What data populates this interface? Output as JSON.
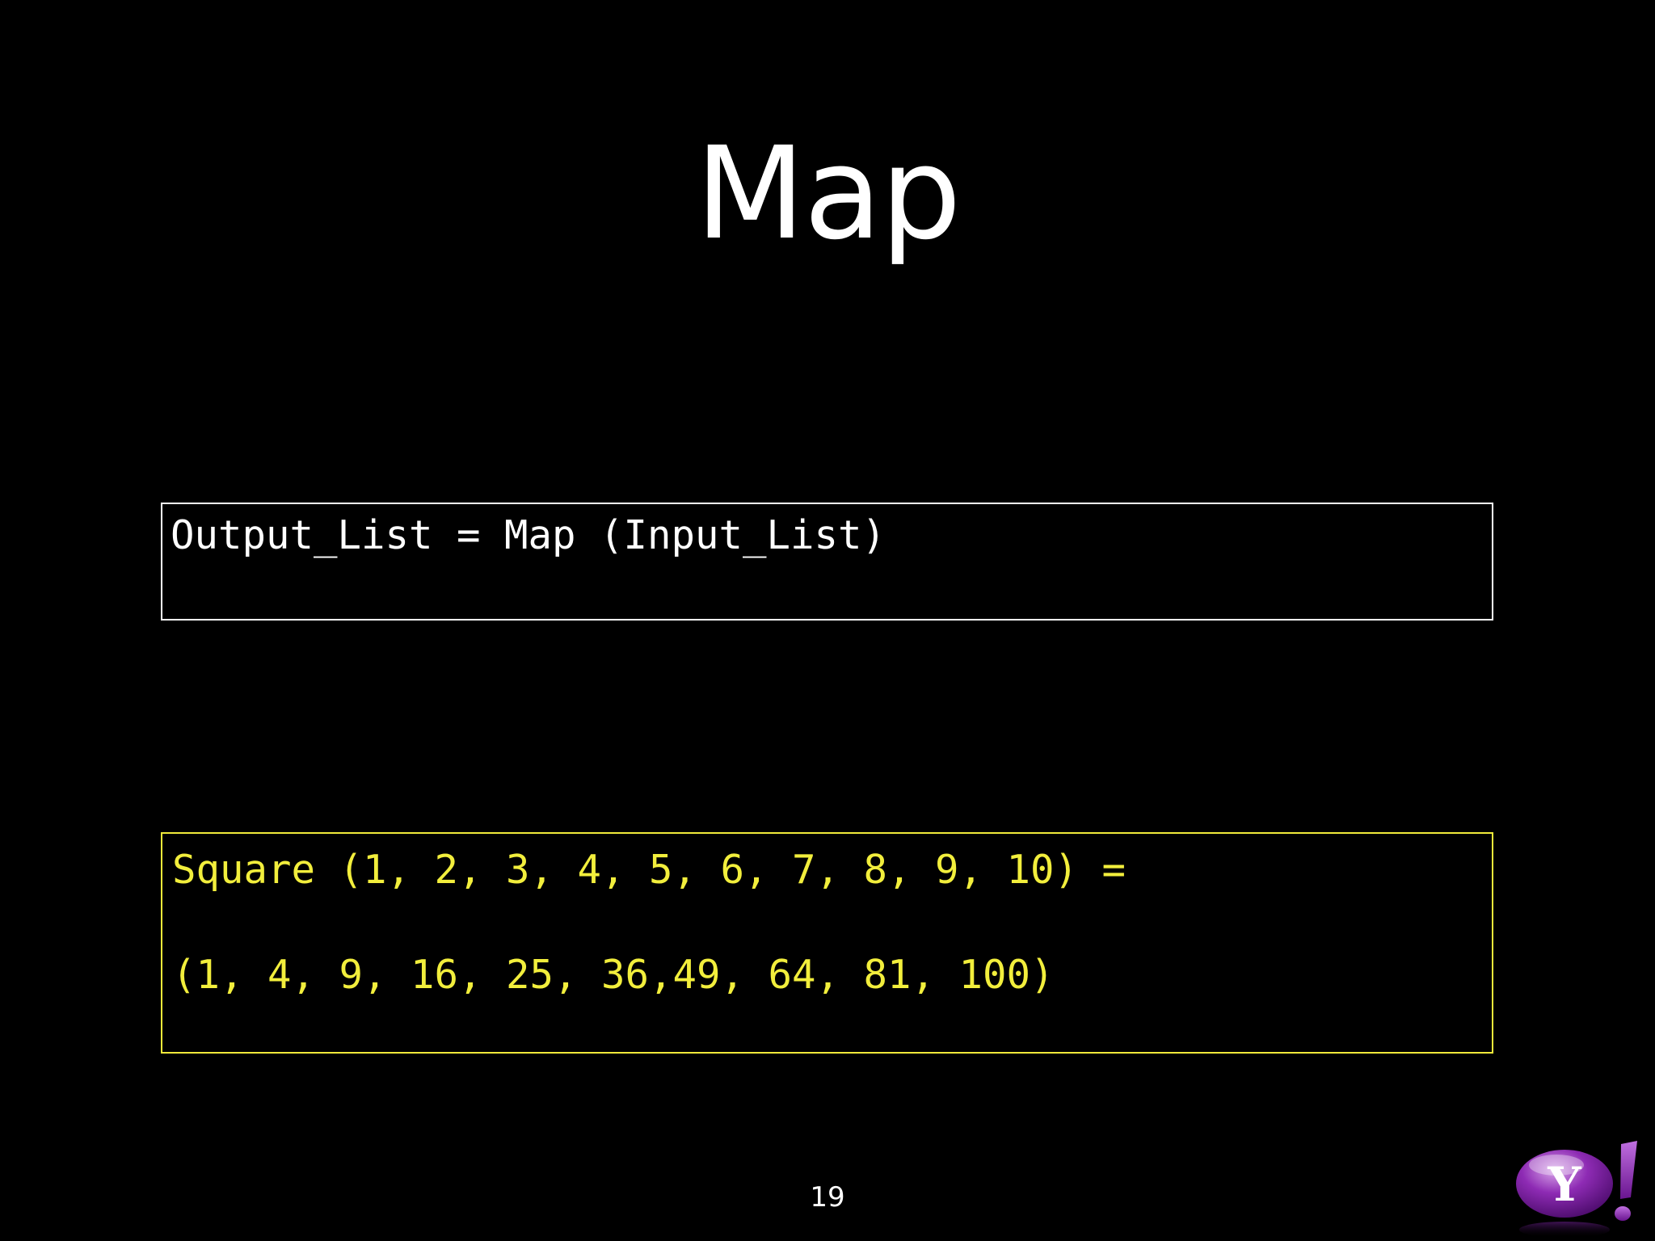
{
  "slide": {
    "title": "Map",
    "page_number": "19"
  },
  "definition_box": {
    "line": "Output_List = Map (Input_List)"
  },
  "example_box": {
    "line1": "Square (1, 2, 3, 4, 5, 6, 7, 8, 9, 10) =",
    "line2": "(1, 4, 9, 16, 25, 36,49, 64, 81, 100)"
  },
  "logo": {
    "icon": "yahoo-logo",
    "text": "Y!"
  },
  "colors": {
    "background": "#000000",
    "text": "#ffffff",
    "highlight": "#f2ee3c",
    "logo_purple": "#7b1fa2"
  }
}
